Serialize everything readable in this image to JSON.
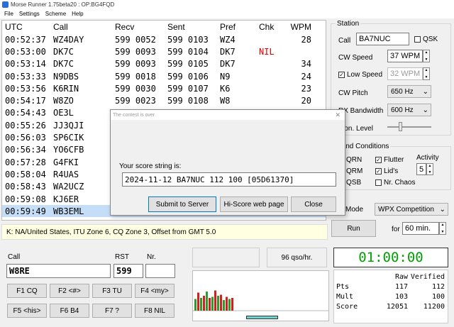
{
  "window": {
    "title": "Morse Runner 1.75beta20 : OP:BG4FQD"
  },
  "menu": [
    "File",
    "Settings",
    "Scheme",
    "Help"
  ],
  "log": {
    "headers": [
      "UTC",
      "Call",
      "Recv",
      "Sent",
      "Pref",
      "Chk",
      "WPM"
    ],
    "rows": [
      {
        "utc": "00:52:37",
        "call": "WZ4DAY",
        "recv": "599 0052",
        "sent": "599 0103",
        "pref": "WZ4",
        "chk": "",
        "wpm": "28"
      },
      {
        "utc": "00:53:00",
        "call": "DK7C",
        "recv": "599 0093",
        "sent": "599 0104",
        "pref": "DK7",
        "chk": "NIL",
        "wpm": ""
      },
      {
        "utc": "00:53:14",
        "call": "DK7C",
        "recv": "599 0093",
        "sent": "599 0105",
        "pref": "DK7",
        "chk": "",
        "wpm": "34"
      },
      {
        "utc": "00:53:33",
        "call": "N9DBS",
        "recv": "599 0018",
        "sent": "599 0106",
        "pref": "N9",
        "chk": "",
        "wpm": "24"
      },
      {
        "utc": "00:53:56",
        "call": "K6RIN",
        "recv": "599 0030",
        "sent": "599 0107",
        "pref": "K6",
        "chk": "",
        "wpm": "23"
      },
      {
        "utc": "00:54:17",
        "call": "W8ZO",
        "recv": "599 0023",
        "sent": "599 0108",
        "pref": "W8",
        "chk": "",
        "wpm": "20"
      },
      {
        "utc": "00:54:43",
        "call": "OE3L",
        "recv": "",
        "sent": "",
        "pref": "",
        "chk": "",
        "wpm": ""
      },
      {
        "utc": "00:55:26",
        "call": "JJ3QJI",
        "recv": "",
        "sent": "",
        "pref": "",
        "chk": "",
        "wpm": ""
      },
      {
        "utc": "00:56:03",
        "call": "SP6CIK",
        "recv": "",
        "sent": "",
        "pref": "",
        "chk": "",
        "wpm": ""
      },
      {
        "utc": "00:56:34",
        "call": "YO6CFB",
        "recv": "",
        "sent": "",
        "pref": "",
        "chk": "",
        "wpm": ""
      },
      {
        "utc": "00:57:28",
        "call": "G4FKI",
        "recv": "",
        "sent": "",
        "pref": "",
        "chk": "",
        "wpm": ""
      },
      {
        "utc": "00:58:04",
        "call": "R4UAS",
        "recv": "",
        "sent": "",
        "pref": "",
        "chk": "",
        "wpm": ""
      },
      {
        "utc": "00:58:43",
        "call": "WA2UCZ",
        "recv": "",
        "sent": "",
        "pref": "",
        "chk": "",
        "wpm": ""
      },
      {
        "utc": "00:59:08",
        "call": "KJ6ER",
        "recv": "",
        "sent": "",
        "pref": "",
        "chk": "",
        "wpm": ""
      },
      {
        "utc": "00:59:49",
        "call": "WB3EML",
        "recv": "",
        "sent": "",
        "pref": "",
        "chk": "",
        "wpm": ""
      }
    ]
  },
  "status_line": "K:  NA/United States, ITU Zone 6,  CQ Zone 3,  Offset from GMT 5.0",
  "station": {
    "group_label": "Station",
    "call_label": "Call",
    "call_value": "BA7NUC",
    "qsk_label": "QSK",
    "cw_speed_label": "CW Speed",
    "cw_speed_value": "37 WPM",
    "low_speed_label": "Low Speed",
    "low_speed_value": "32 WPM",
    "cw_pitch_label": "CW Pitch",
    "cw_pitch_value": "650 Hz",
    "rx_bw_label": "RX Bandwidth",
    "rx_bw_value": "600 Hz",
    "mon_level_label": "Mon. Level"
  },
  "band": {
    "group_label": "Band Conditions",
    "qrn": "QRN",
    "qrm": "QRM",
    "qsb": "QSB",
    "flutter": "Flutter",
    "lids": "Lid's",
    "nr_chaos": "Nr. Chaos",
    "activity_label": "Activity",
    "activity_value": "5"
  },
  "contest": {
    "mode_label": "Mode",
    "mode_value": "WPX Competition",
    "run_label": "Run",
    "for_label": "for",
    "duration_value": "60 min."
  },
  "entry": {
    "call_label": "Call",
    "call_value": "W8RE",
    "rst_label": "RST",
    "rst_value": "599",
    "nr_label": "Nr.",
    "nr_value": ""
  },
  "fkeys": [
    "F1  CQ",
    "F2  <#>",
    "F3  TU",
    "F4  <my>",
    "F5  <his>",
    "F6  B4",
    "F7  ?",
    "F8  NIL"
  ],
  "rate": "96  qso/hr.",
  "clock": "01:00:00",
  "score_table": {
    "headers": [
      "",
      "Raw",
      "Verified"
    ],
    "rows": [
      {
        "label": "Pts",
        "raw": "117",
        "verified": "112"
      },
      {
        "label": "Mult",
        "raw": "103",
        "verified": "100"
      },
      {
        "label": "Score",
        "raw": "12051",
        "verified": "11200"
      }
    ]
  },
  "graph": {
    "values": [
      0.55,
      0.85,
      0.6,
      0.7,
      0.9,
      0.6,
      0.65,
      0.95,
      0.7,
      0.75,
      0.5,
      0.65,
      0.55,
      0.6
    ]
  },
  "dialog": {
    "title": "The contest is over",
    "prompt": "Your score string is:",
    "score_string": "2024-11-12  BA7NUC  112  100  [05D61370]",
    "submit_label": "Submit to Server",
    "hiscore_label": "Hi-Score web page",
    "close_label": "Close"
  },
  "colors": {
    "clock": "#00a000",
    "nil": "#e00000",
    "bar_green": "#2f9a2f",
    "bar_red": "#d02020"
  }
}
